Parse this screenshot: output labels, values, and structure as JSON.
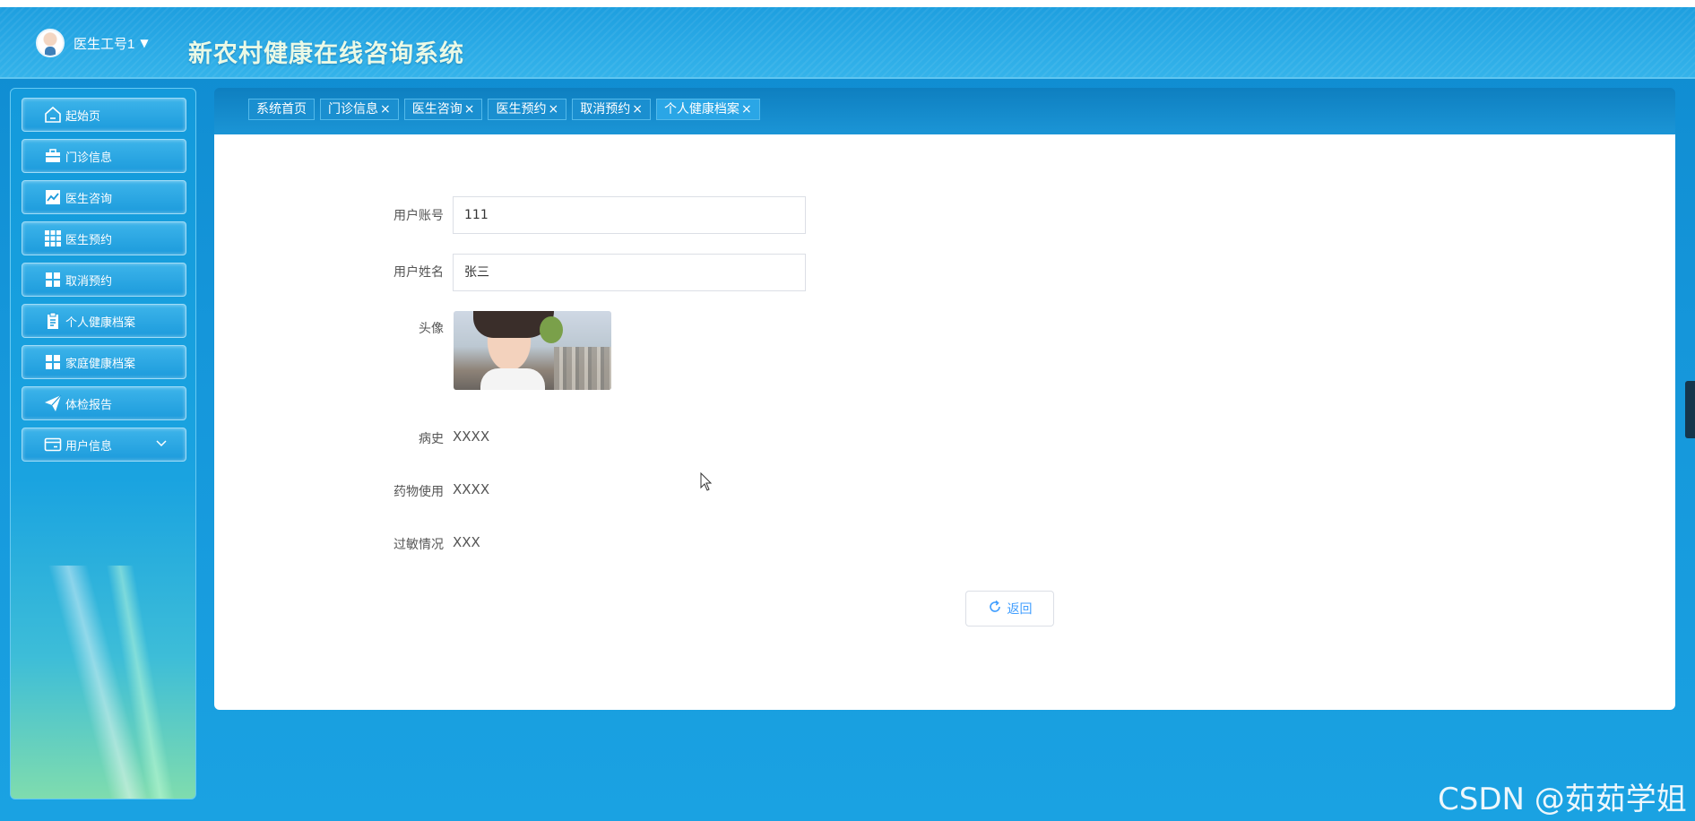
{
  "header": {
    "user_name": "医生工号1",
    "caret": "▼",
    "system_title": "新农村健康在线咨询系统"
  },
  "sidebar": {
    "items": [
      {
        "label": "起始页",
        "icon": "home-icon"
      },
      {
        "label": "门诊信息",
        "icon": "briefcase-icon"
      },
      {
        "label": "医生咨询",
        "icon": "chart-icon"
      },
      {
        "label": "医生预约",
        "icon": "grid-icon"
      },
      {
        "label": "取消预约",
        "icon": "apps-icon"
      },
      {
        "label": "个人健康档案",
        "icon": "clipboard-icon"
      },
      {
        "label": "家庭健康档案",
        "icon": "apps-icon"
      },
      {
        "label": "体检报告",
        "icon": "paper-plane-icon"
      },
      {
        "label": "用户信息",
        "icon": "card-icon",
        "expandable": true
      }
    ]
  },
  "tabs": [
    {
      "label": "系统首页",
      "closable": false
    },
    {
      "label": "门诊信息",
      "closable": true
    },
    {
      "label": "医生咨询",
      "closable": true
    },
    {
      "label": "医生预约",
      "closable": true
    },
    {
      "label": "取消预约",
      "closable": true
    },
    {
      "label": "个人健康档案",
      "closable": true,
      "active": true
    }
  ],
  "tab_close": "×",
  "form": {
    "account_label": "用户账号",
    "account_value": "111",
    "name_label": "用户姓名",
    "name_value": "张三",
    "avatar_label": "头像",
    "history_label": "病史",
    "history_value": "XXXX",
    "medication_label": "药物使用",
    "medication_value": "XXXX",
    "allergy_label": "过敏情况",
    "allergy_value": "XXX"
  },
  "actions": {
    "back_label": "返回"
  },
  "watermark": "CSDN @茹茹学姐",
  "colors": {
    "primary": "#1596da",
    "button_text": "#409eff",
    "title_text": "#eaf9e6"
  }
}
